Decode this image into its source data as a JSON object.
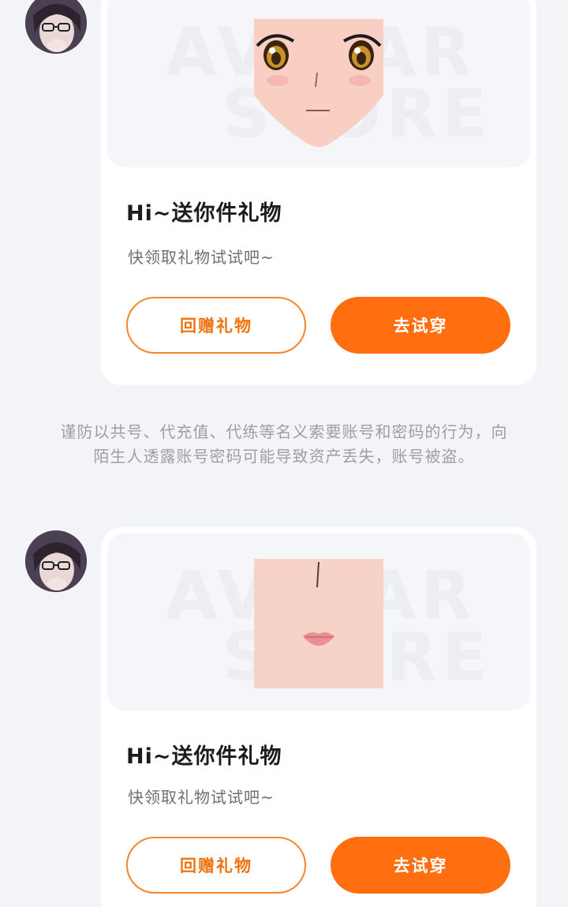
{
  "messages": [
    {
      "avatar_icon": "user-avatar-photo",
      "item_icon": "anime-eyes-face",
      "watermark_line1": "AVATAR",
      "watermark_line2": "STORE",
      "title": "Hi~送你件礼物",
      "subtitle": "快领取礼物试试吧~",
      "return_gift_label": "回赠礼物",
      "try_on_label": "去试穿"
    },
    {
      "avatar_icon": "user-avatar-photo",
      "item_icon": "nose-lips-face",
      "watermark_line1": "AVATAR",
      "watermark_line2": "STORE",
      "title": "Hi~送你件礼物",
      "subtitle": "快领取礼物试试吧~",
      "return_gift_label": "回赠礼物",
      "try_on_label": "去试穿"
    }
  ],
  "notice": "谨防以共号、代充值、代练等名义索要账号和密码的行为，向陌生人透露账号密码可能导致资产丢失，账号被盗。",
  "colors": {
    "accent": "#ff6e0f",
    "accent_border": "#f5862a",
    "background": "#f3f4f8",
    "card": "#ffffff",
    "muted_text": "#9d9ea6"
  }
}
